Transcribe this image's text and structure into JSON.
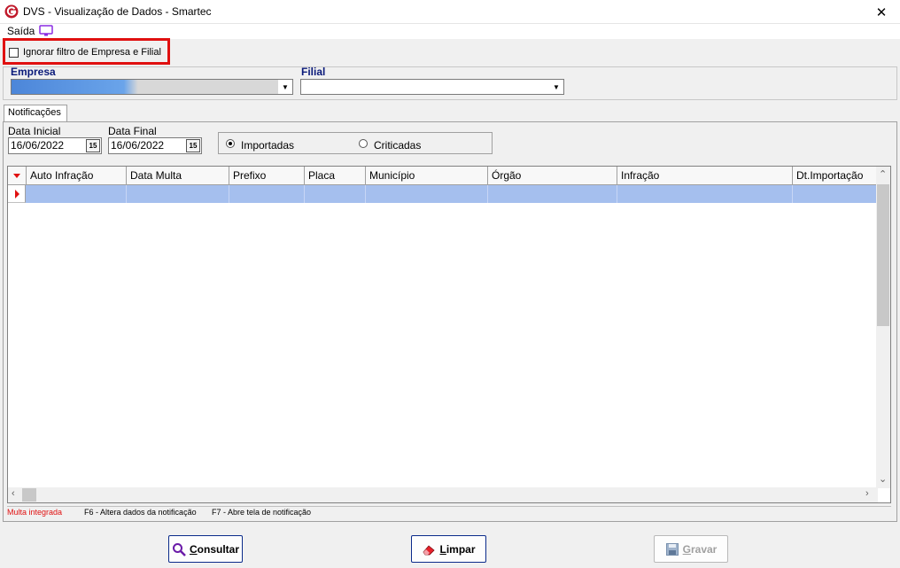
{
  "window": {
    "title": "DVS - Visualização de Dados - Smartec",
    "close": "✕"
  },
  "menu": {
    "saida": "Saída"
  },
  "filter": {
    "ignore_label": "Ignorar filtro de Empresa e Filial",
    "ignore_checked": false
  },
  "header": {
    "empresa_label": "Empresa",
    "empresa_value": "",
    "filial_label": "Filial",
    "filial_value": ""
  },
  "tabs": [
    {
      "label": "Notificações",
      "active": true
    }
  ],
  "dates": {
    "initial_label": "Data Inicial",
    "initial_value": "16/06/2022",
    "final_label": "Data Final",
    "final_value": "16/06/2022",
    "calendar_glyph": "15"
  },
  "radio": {
    "options": [
      {
        "label": "Importadas",
        "selected": true
      },
      {
        "label": "Criticadas",
        "selected": false
      }
    ]
  },
  "grid": {
    "columns": [
      "Auto Infração",
      "Data Multa",
      "Prefixo",
      "Placa",
      "Município",
      "Órgão",
      "Infração",
      "Dt.Importação"
    ],
    "rows": [
      [
        "",
        "",
        "",
        "",
        "",
        "",
        "",
        ""
      ]
    ]
  },
  "status": {
    "legend_red": "Multa integrada",
    "hint_f6": "F6 - Altera dados da notificação",
    "hint_f7": "F7 - Abre tela de notificação"
  },
  "buttons": {
    "consultar": "Consultar",
    "limpar": "Limpar",
    "gravar": "Gravar"
  },
  "colors": {
    "accent_red": "#e01010",
    "label_blue": "#0a1a7a",
    "row_selected": "#a5bfee"
  }
}
